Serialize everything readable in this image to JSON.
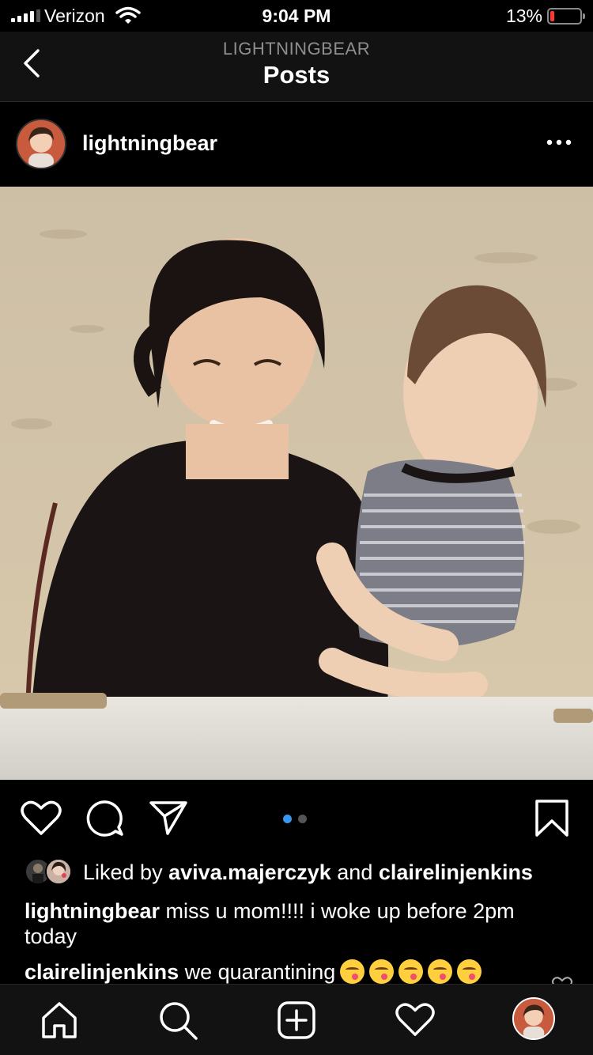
{
  "status_bar": {
    "carrier": "Verizon",
    "time": "9:04 PM",
    "battery_percent": "13%",
    "battery_level": 0.13,
    "battery_color": "#ff3b30",
    "signal_bars": 4
  },
  "header": {
    "account": "LIGHTNINGBEAR",
    "title": "Posts"
  },
  "post": {
    "username": "lightningbear",
    "carousel": {
      "count": 2,
      "active_index": 0
    },
    "likes": {
      "prefix": "Liked by",
      "user1": "aviva.majerczyk",
      "joiner": "and",
      "user2": "clairelinjenkins"
    },
    "caption": {
      "username": "lightningbear",
      "text": "miss u mom!!!! i woke up before 2pm today"
    },
    "comment": {
      "username": "clairelinjenkins",
      "text": "we quarantining",
      "emoji": "face-savoring-food-emoji",
      "emoji_count": 5
    }
  },
  "tabbar": {
    "items": [
      "home-icon",
      "search-icon",
      "new-post-icon",
      "activity-icon",
      "profile-avatar"
    ]
  },
  "colors": {
    "accent_blue": "#3897f0",
    "background": "#000000",
    "bar_background": "#121212"
  }
}
